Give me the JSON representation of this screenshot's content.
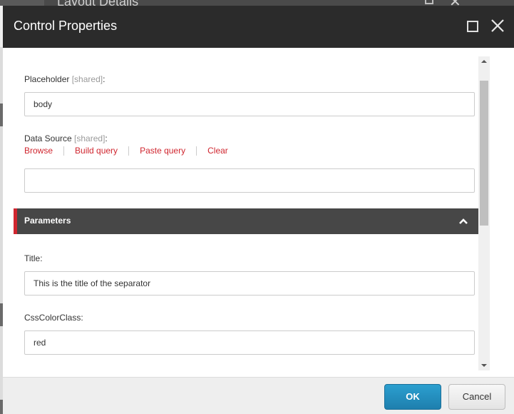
{
  "background_window": {
    "title": "Layout Details"
  },
  "dialog": {
    "title": "Control Properties",
    "maximize_icon": "maximize-icon",
    "close_icon": "close-icon"
  },
  "fields": {
    "placeholder": {
      "label": "Placeholder",
      "shared": "[shared]",
      "suffix": ":",
      "value": "body"
    },
    "data_source": {
      "label": "Data Source",
      "shared": "[shared]",
      "suffix": ":",
      "value": "",
      "links": [
        "Browse",
        "Build query",
        "Paste query",
        "Clear"
      ]
    }
  },
  "parameters_section": {
    "title": "Parameters",
    "expanded": true,
    "toggle_icon": "chevron-up-icon",
    "fields": [
      {
        "label": "Title:",
        "value": "This is the title of the separator"
      },
      {
        "label": "CssColorClass:",
        "value": "red"
      }
    ]
  },
  "footer": {
    "ok_label": "OK",
    "cancel_label": "Cancel"
  },
  "colors": {
    "accent_red": "#d0262f",
    "header_dark": "#2b2b2b",
    "section_dark": "#474747",
    "ok_blue": "#2290c0"
  }
}
